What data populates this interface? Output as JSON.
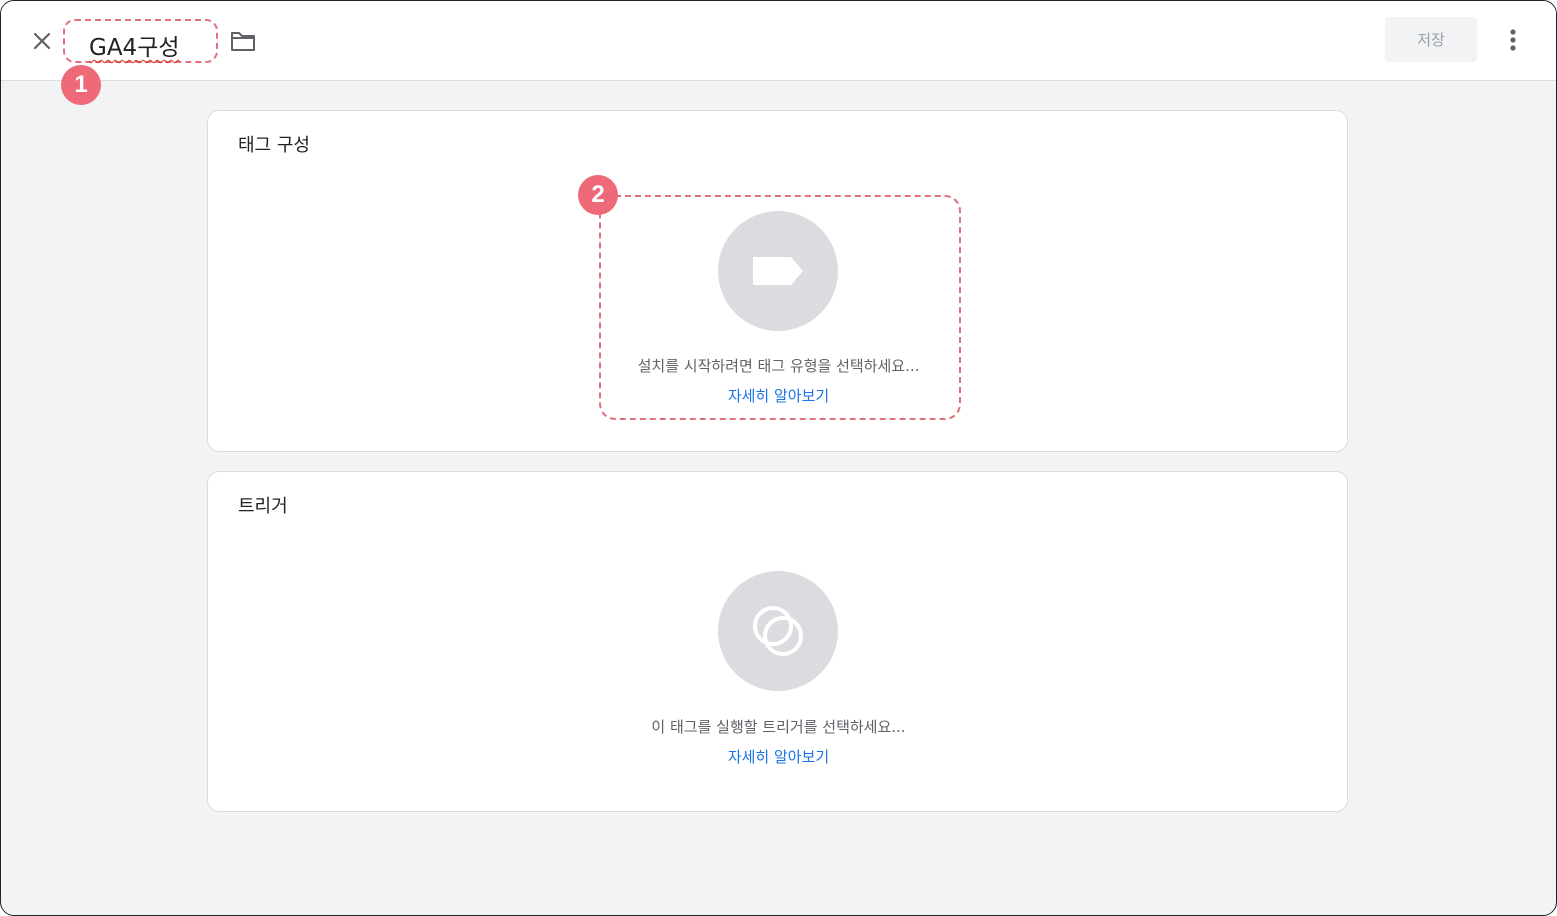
{
  "header": {
    "title": "GA4구성",
    "save_label": "저장",
    "badge_1": "1"
  },
  "tag_config": {
    "title": "태그 구성",
    "badge_2": "2",
    "hint": "설치를 시작하려면 태그 유형을 선택하세요...",
    "learn_more": "자세히 알아보기"
  },
  "trigger": {
    "title": "트리거",
    "hint": "이 태그를 실행할 트리거를 선택하세요...",
    "learn_more": "자세히 알아보기"
  },
  "colors": {
    "accent_link": "#1a73e8",
    "annotation": "#ee6a78",
    "icon_circle": "#dadce0"
  }
}
